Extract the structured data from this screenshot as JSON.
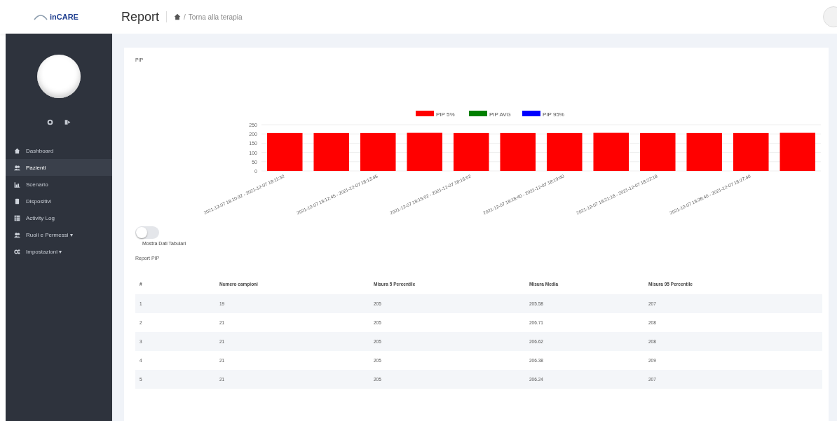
{
  "header": {
    "logo": "inCARE",
    "title": "Report",
    "separator": "/",
    "breadcrumb": "Torna alla terapia"
  },
  "sidebar": {
    "items": [
      {
        "label": "Dashboard",
        "selected": false
      },
      {
        "label": "Pazienti",
        "selected": true
      },
      {
        "label": "Scenario",
        "selected": false
      },
      {
        "label": "Dispositivi",
        "selected": false
      },
      {
        "label": "Activity Log",
        "selected": false
      },
      {
        "label": "Ruoli e Permessi",
        "selected": false,
        "caret": "▾"
      },
      {
        "label": "Impostazioni",
        "selected": false,
        "caret": "▾"
      }
    ]
  },
  "card": {
    "title": "PIP",
    "chart_data": {
      "type": "bar",
      "categories": [
        "2021-12-07 18:10:32 - 2021-12-07 18:11:32",
        null,
        "2021-12-07 18:12:45 - 2021-12-07 18:13:45",
        null,
        "2021-12-07 18:15:02 - 2021-12-07 18:16:02",
        null,
        "2021-12-07 18:18:40 - 2021-12-07 18:19:40",
        null,
        "2021-12-07 18:21:18 - 2021-12-07 18:22:18",
        null,
        "2021-12-07 18:26:40 - 2021-12-07 18:27:40",
        null
      ],
      "series": [
        {
          "name": "PIP 5%",
          "color": "#ff0000",
          "values": [
            205,
            205,
            205,
            206,
            205,
            205,
            205,
            206,
            205,
            205,
            205,
            206
          ]
        },
        {
          "name": "PIP AVG",
          "color": "#008000",
          "values": [
            null,
            null,
            null,
            null,
            null,
            null,
            null,
            null,
            null,
            null,
            null,
            null
          ]
        },
        {
          "name": "PIP 95%",
          "color": "#0000ff",
          "values": [
            null,
            null,
            null,
            null,
            null,
            null,
            null,
            null,
            null,
            null,
            null,
            null
          ]
        }
      ],
      "ylim": [
        0,
        250
      ],
      "yticks": [
        0,
        50,
        100,
        150,
        200,
        250
      ],
      "grid": true
    },
    "toggle": {
      "label": "Mostra Dati Tabulari",
      "on": false
    },
    "table_title": "Report PIP",
    "table": {
      "columns": [
        "#",
        "Numero campioni",
        "Misura 5 Percentile",
        "Misura Media",
        "Misura 95 Percentile"
      ],
      "rows": [
        [
          "1",
          "19",
          "205",
          "205.58",
          "207"
        ],
        [
          "2",
          "21",
          "205",
          "206.71",
          "208"
        ],
        [
          "3",
          "21",
          "205",
          "206.62",
          "208"
        ],
        [
          "4",
          "21",
          "205",
          "206.38",
          "209"
        ],
        [
          "5",
          "21",
          "205",
          "206.24",
          "207"
        ]
      ]
    }
  }
}
